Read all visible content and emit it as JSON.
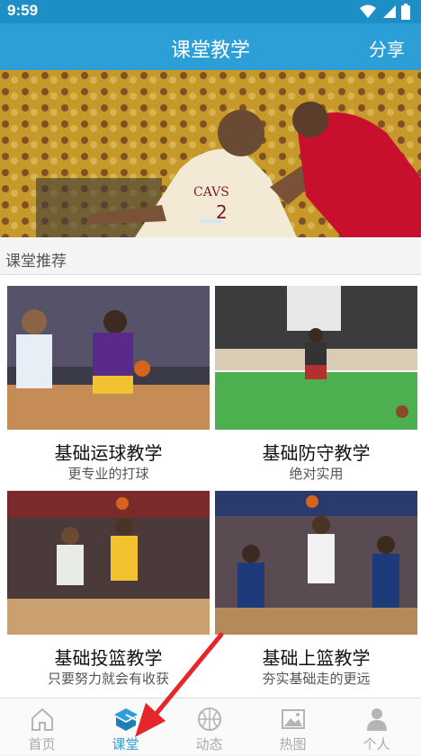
{
  "status_bar": {
    "time": "9:59"
  },
  "header": {
    "title": "课堂教学",
    "share_label": "分享"
  },
  "section": {
    "title": "课堂推荐"
  },
  "courses": [
    {
      "title": "基础运球教学",
      "subtitle": "更专业的打球"
    },
    {
      "title": "基础防守教学",
      "subtitle": "绝对实用"
    },
    {
      "title": "基础投篮教学",
      "subtitle": "只要努力就会有收获"
    },
    {
      "title": "基础上篮教学",
      "subtitle": "夯实基础走的更远"
    }
  ],
  "nav": {
    "items": [
      {
        "label": "首页",
        "icon": "home-icon"
      },
      {
        "label": "课堂",
        "icon": "classroom-icon",
        "active": true
      },
      {
        "label": "动态",
        "icon": "basketball-icon"
      },
      {
        "label": "热图",
        "icon": "image-icon"
      },
      {
        "label": "个人",
        "icon": "person-icon"
      }
    ]
  },
  "colors": {
    "primary": "#2b9fd6",
    "status_bar": "#1e8fc4",
    "annotation_arrow": "#e5262b"
  }
}
